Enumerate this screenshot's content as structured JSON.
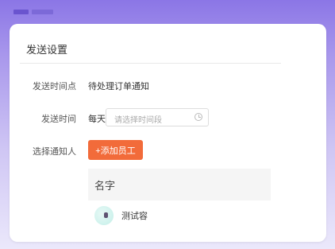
{
  "card": {
    "title": "发送设置"
  },
  "form": {
    "send_time_point_label": "发送时间点",
    "send_time_point_value": "待处理订单通知",
    "send_time_label": "发送时间",
    "send_time_prefix": "每天",
    "time_input_placeholder": "请选择时间段",
    "notify_label": "选择通知人",
    "add_button_label": "+添加员工"
  },
  "table": {
    "header": "名字",
    "rows": [
      {
        "name": "测试容"
      }
    ]
  },
  "colors": {
    "accent": "#f26b3a",
    "background_top": "#8b76e6"
  }
}
